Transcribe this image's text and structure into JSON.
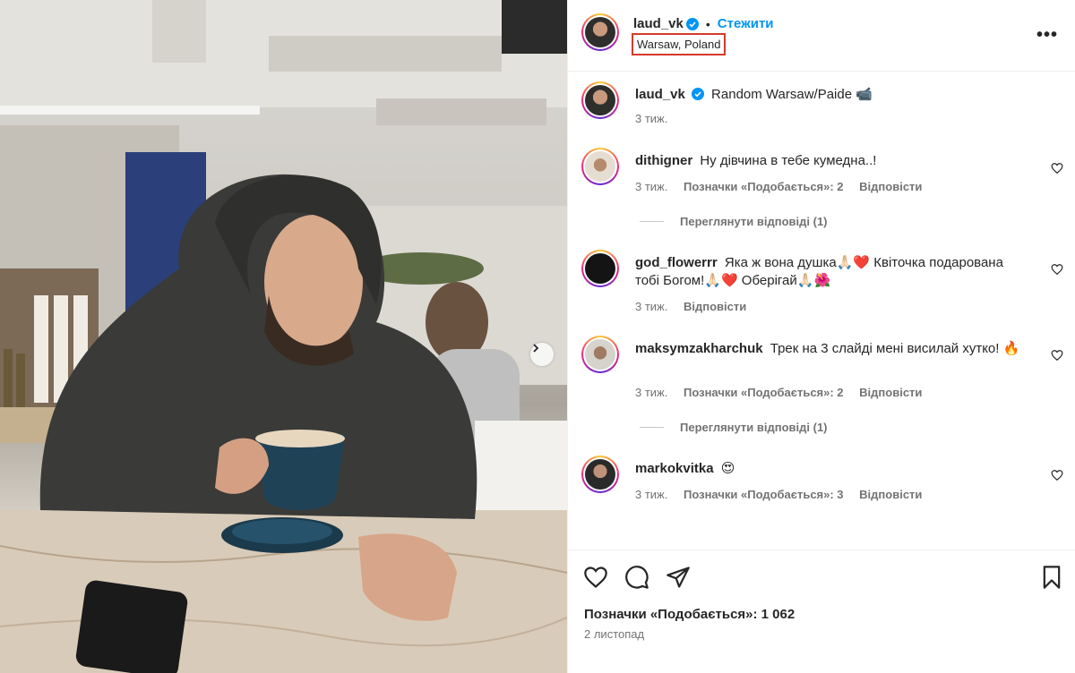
{
  "post_author": {
    "username": "laud_vk",
    "follow_label": "Стежити",
    "dot": "•",
    "location": "Warsaw, Poland",
    "more_label": "•••"
  },
  "caption": {
    "username": "laud_vk",
    "text": "Random Warsaw/Paide 📹",
    "time": "3 тиж."
  },
  "comments": [
    {
      "username": "dithigner",
      "text": "Ну дівчина в тебе кумедна..!",
      "time": "3 тиж.",
      "likes": "Позначки «Подобається»: 2",
      "reply": "Відповісти",
      "view_replies": "Переглянути відповіді (1)"
    },
    {
      "username": "god_flowerrr",
      "text": "Яка ж вона душка🙏🏻❤️ Квіточка подарована тобі Богом!🙏🏻❤️ Оберігай🙏🏻🌺",
      "time": "3 тиж.",
      "reply": "Відповісти"
    },
    {
      "username": "maksymzakharchuk",
      "text": "Трек на 3 слайді мені висилай хутко! 🔥",
      "time": "3 тиж.",
      "likes": "Позначки «Подобається»: 2",
      "reply": "Відповісти",
      "view_replies": "Переглянути відповіді (1)"
    },
    {
      "username": "markokvitka",
      "text": "😍",
      "time": "3 тиж.",
      "likes": "Позначки «Подобається»: 3",
      "reply": "Відповісти"
    }
  ],
  "footer": {
    "likes": "Позначки «Подобається»: 1 062",
    "date": "2 листопад"
  },
  "colors": {
    "accent": "#0095f6",
    "verified": "#0095f6",
    "highlight_box": "#d33a2a",
    "muted_text": "#737373"
  },
  "icons": [
    "verified-badge-icon",
    "more-icon",
    "heart-icon",
    "comment-icon",
    "share-icon",
    "bookmark-icon",
    "chevron-right-icon"
  ]
}
